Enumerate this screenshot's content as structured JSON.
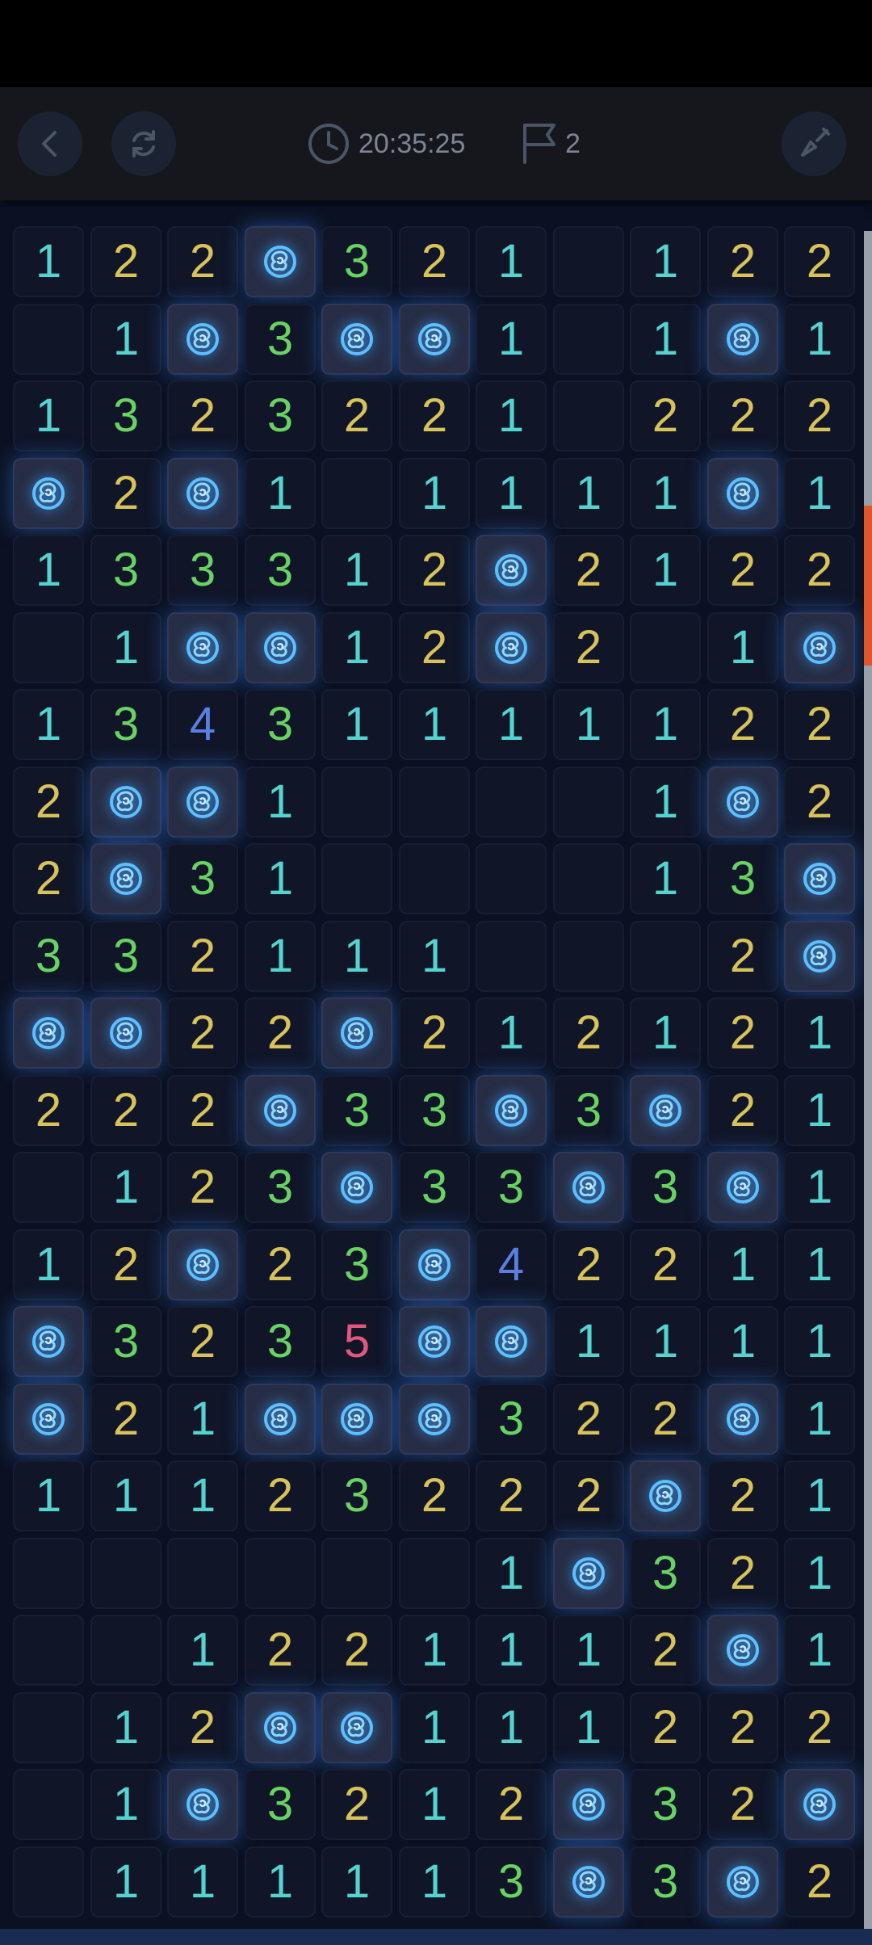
{
  "toolbar": {
    "back_icon": "chevron-left-icon",
    "restart_icon": "refresh-icon",
    "timer_icon": "clock-icon",
    "timer": "20:35:25",
    "flag_icon": "flag-icon",
    "flag_count": "2",
    "tool_icon": "shovel-icon"
  },
  "board": {
    "mine_icon": "rose-icon",
    "number_colors": {
      "1": "#55d3cf",
      "2": "#d8c25a",
      "3": "#68d262",
      "4": "#5b7fe0",
      "5": "#e0587e"
    },
    "rows": [
      [
        "1",
        "2",
        "2",
        "M",
        "3",
        "2",
        "1",
        "",
        "1",
        "2",
        "2"
      ],
      [
        "",
        "1",
        "M",
        "3",
        "M",
        "M",
        "1",
        "",
        "1",
        "M",
        "1"
      ],
      [
        "1",
        "3",
        "2",
        "3",
        "2",
        "2",
        "1",
        "",
        "2",
        "2",
        "2"
      ],
      [
        "M",
        "2",
        "M",
        "1",
        "",
        "1",
        "1",
        "1",
        "1",
        "M",
        "1"
      ],
      [
        "1",
        "3",
        "3",
        "3",
        "1",
        "2",
        "M",
        "2",
        "1",
        "2",
        "2"
      ],
      [
        "",
        "1",
        "M",
        "M",
        "1",
        "2",
        "M",
        "2",
        "",
        "1",
        "M"
      ],
      [
        "1",
        "3",
        "4",
        "3",
        "1",
        "1",
        "1",
        "1",
        "1",
        "2",
        "2"
      ],
      [
        "2",
        "M",
        "M",
        "1",
        "",
        "",
        "",
        "",
        "1",
        "M",
        "2"
      ],
      [
        "2",
        "M",
        "3",
        "1",
        "",
        "",
        "",
        "",
        "1",
        "3",
        "M"
      ],
      [
        "3",
        "3",
        "2",
        "1",
        "1",
        "1",
        "",
        "",
        "",
        "2",
        "M"
      ],
      [
        "M",
        "M",
        "2",
        "2",
        "M",
        "2",
        "1",
        "2",
        "1",
        "2",
        "1"
      ],
      [
        "2",
        "2",
        "2",
        "M",
        "3",
        "3",
        "M",
        "3",
        "M",
        "2",
        "1"
      ],
      [
        "",
        "1",
        "2",
        "3",
        "M",
        "3",
        "3",
        "M",
        "3",
        "M",
        "1"
      ],
      [
        "1",
        "2",
        "M",
        "2",
        "3",
        "M",
        "4",
        "2",
        "2",
        "1",
        "1"
      ],
      [
        "M",
        "3",
        "2",
        "3",
        "5",
        "M",
        "M",
        "1",
        "1",
        "1",
        "1"
      ],
      [
        "M",
        "2",
        "1",
        "M",
        "M",
        "M",
        "3",
        "2",
        "2",
        "M",
        "1"
      ],
      [
        "1",
        "1",
        "1",
        "2",
        "3",
        "2",
        "2",
        "2",
        "M",
        "2",
        "1"
      ],
      [
        "",
        "",
        "",
        "",
        "",
        "",
        "1",
        "M",
        "3",
        "2",
        "1"
      ],
      [
        "",
        "",
        "1",
        "2",
        "2",
        "1",
        "1",
        "1",
        "2",
        "M",
        "1"
      ],
      [
        "",
        "1",
        "2",
        "M",
        "M",
        "1",
        "1",
        "1",
        "2",
        "2",
        "2"
      ],
      [
        "",
        "1",
        "M",
        "3",
        "2",
        "1",
        "2",
        "M",
        "3",
        "2",
        "M"
      ],
      [
        "",
        "1",
        "1",
        "1",
        "1",
        "1",
        "3",
        "M",
        "3",
        "M",
        "2"
      ]
    ]
  }
}
